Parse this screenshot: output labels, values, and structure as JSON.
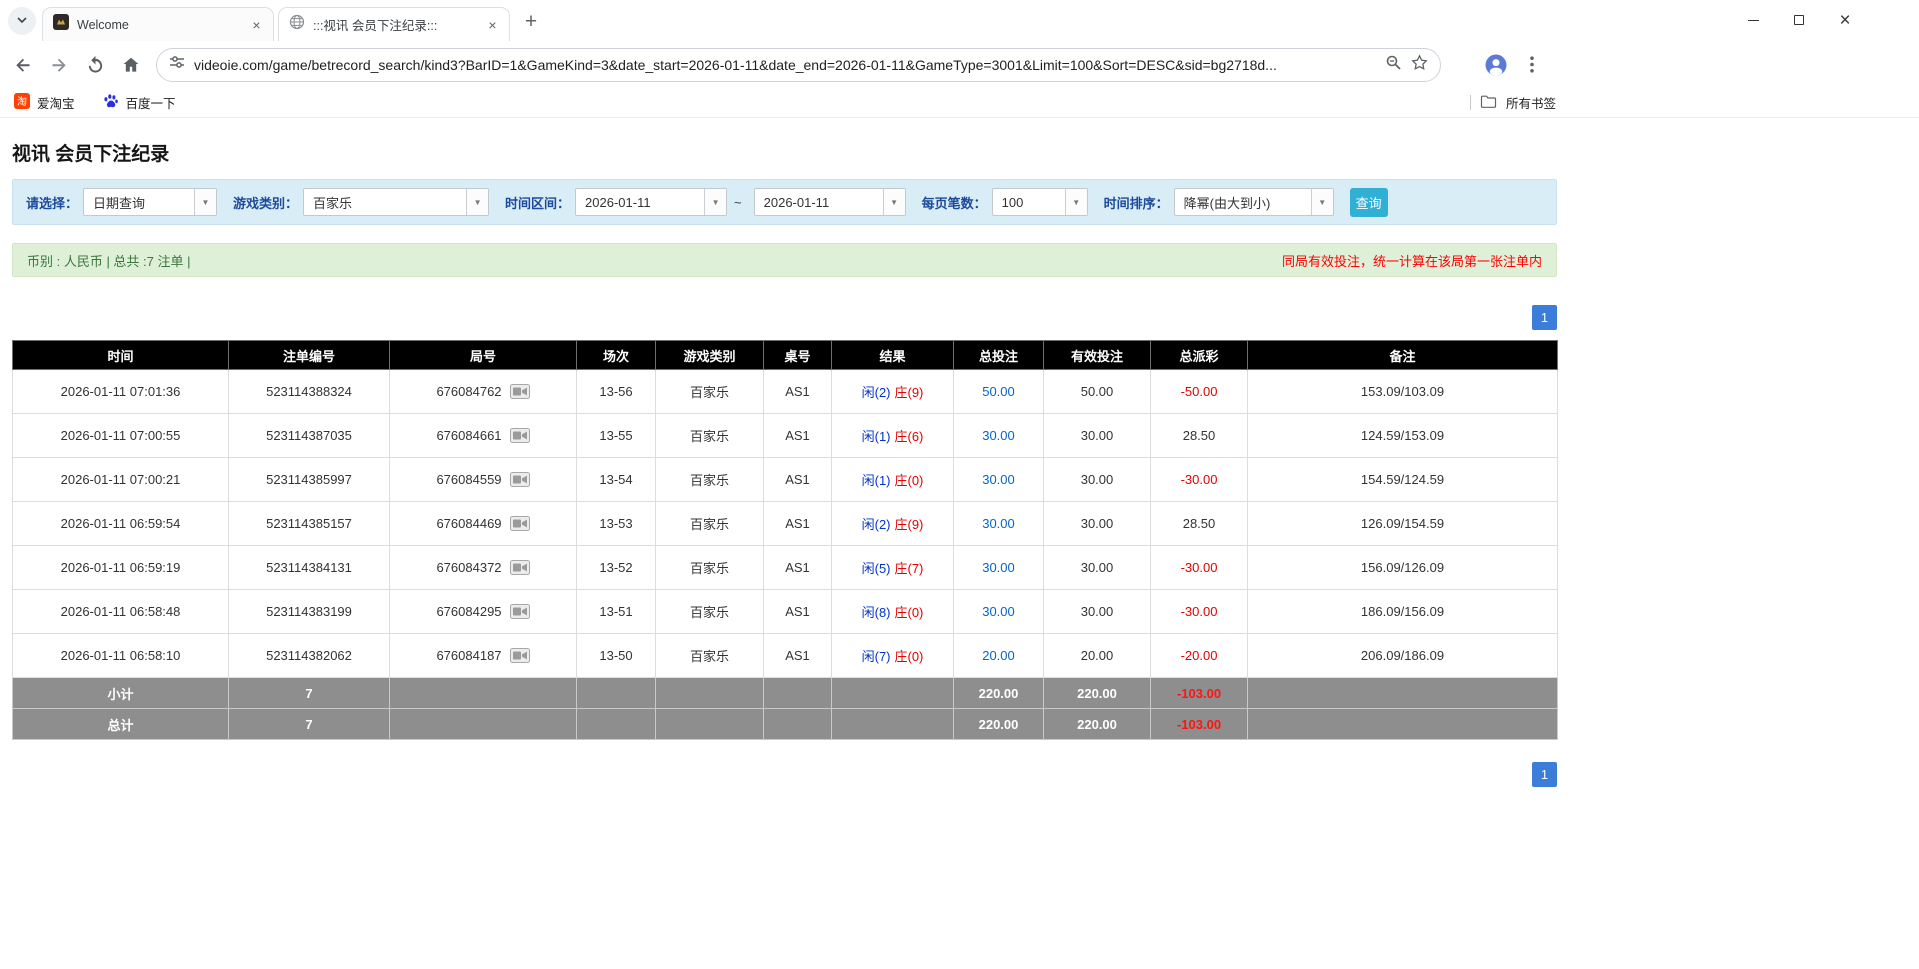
{
  "colors": {
    "player_blue": "#0033cc",
    "banker_red": "#e60000",
    "amount_link_blue": "#0066cc",
    "negative_red": "#e60000",
    "search_button_cyan": "#31b0d5",
    "pager_blue": "#3b7dd8",
    "filter_bar_bg": "#d9edf7",
    "info_bar_bg": "#dff0d8",
    "table_header_bg": "#000000",
    "total_row_gray": "#8e8e8e"
  },
  "browser": {
    "tabs": [
      {
        "title": "Welcome"
      },
      {
        "title": ":::视讯 会员下注纪录:::"
      }
    ],
    "url": "videoie.com/game/betrecord_search/kind3?BarID=1&GameKind=3&date_start=2026-01-11&date_end=2026-01-11&GameType=3001&Limit=100&Sort=DESC&sid=bg2718d...",
    "bookmarks": {
      "items": [
        {
          "label": "爱淘宝"
        },
        {
          "label": "百度一下"
        }
      ],
      "all_bookmarks": "所有书签"
    }
  },
  "page": {
    "title": "视讯 会员下注纪录",
    "filters": {
      "mode_label": "请选择：",
      "mode_value": "日期查询",
      "game_label": "游戏类别：",
      "game_value": "百家乐",
      "range_label": "时间区间：",
      "date_start": "2026-01-11",
      "range_separator": "~",
      "date_end": "2026-01-11",
      "page_size_label": "每页笔数：",
      "page_size_value": "100",
      "sort_label": "时间排序：",
      "sort_value": "降幂(由大到小)",
      "search_button": "查询"
    },
    "info_bar": {
      "summary": "币别 : 人民币 | 总共 :7 注单 |",
      "notice": "同局有效投注，统一计算在该局第一张注单内"
    },
    "pagination": {
      "page": "1"
    },
    "table": {
      "headers": [
        "时间",
        "注单编号",
        "局号",
        "场次",
        "游戏类别",
        "桌号",
        "结果",
        "总投注",
        "有效投注",
        "总派彩",
        "备注"
      ],
      "rows": [
        {
          "time": "2026-01-11 07:01:36",
          "bet_id": "523114388324",
          "round": "676084762",
          "session": "13-56",
          "game": "百家乐",
          "table_no": "AS1",
          "player": "闲(2)",
          "banker": "庄(9)",
          "total_bet": "50.00",
          "valid_bet": "50.00",
          "payout": "-50.00",
          "note": "153.09/103.09"
        },
        {
          "time": "2026-01-11 07:00:55",
          "bet_id": "523114387035",
          "round": "676084661",
          "session": "13-55",
          "game": "百家乐",
          "table_no": "AS1",
          "player": "闲(1)",
          "banker": "庄(6)",
          "total_bet": "30.00",
          "valid_bet": "30.00",
          "payout": "28.50",
          "note": "124.59/153.09"
        },
        {
          "time": "2026-01-11 07:00:21",
          "bet_id": "523114385997",
          "round": "676084559",
          "session": "13-54",
          "game": "百家乐",
          "table_no": "AS1",
          "player": "闲(1)",
          "banker": "庄(0)",
          "total_bet": "30.00",
          "valid_bet": "30.00",
          "payout": "-30.00",
          "note": "154.59/124.59"
        },
        {
          "time": "2026-01-11 06:59:54",
          "bet_id": "523114385157",
          "round": "676084469",
          "session": "13-53",
          "game": "百家乐",
          "table_no": "AS1",
          "player": "闲(2)",
          "banker": "庄(9)",
          "total_bet": "30.00",
          "valid_bet": "30.00",
          "payout": "28.50",
          "note": "126.09/154.59"
        },
        {
          "time": "2026-01-11 06:59:19",
          "bet_id": "523114384131",
          "round": "676084372",
          "session": "13-52",
          "game": "百家乐",
          "table_no": "AS1",
          "player": "闲(5)",
          "banker": "庄(7)",
          "total_bet": "30.00",
          "valid_bet": "30.00",
          "payout": "-30.00",
          "note": "156.09/126.09"
        },
        {
          "time": "2026-01-11 06:58:48",
          "bet_id": "523114383199",
          "round": "676084295",
          "session": "13-51",
          "game": "百家乐",
          "table_no": "AS1",
          "player": "闲(8)",
          "banker": "庄(0)",
          "total_bet": "30.00",
          "valid_bet": "30.00",
          "payout": "-30.00",
          "note": "186.09/156.09"
        },
        {
          "time": "2026-01-11 06:58:10",
          "bet_id": "523114382062",
          "round": "676084187",
          "session": "13-50",
          "game": "百家乐",
          "table_no": "AS1",
          "player": "闲(7)",
          "banker": "庄(0)",
          "total_bet": "20.00",
          "valid_bet": "20.00",
          "payout": "-20.00",
          "note": "206.09/186.09"
        }
      ],
      "subtotal": {
        "label": "小计",
        "count": "7",
        "total_bet": "220.00",
        "valid_bet": "220.00",
        "payout": "-103.00"
      },
      "grand_total": {
        "label": "总计",
        "count": "7",
        "total_bet": "220.00",
        "valid_bet": "220.00",
        "payout": "-103.00"
      }
    }
  }
}
